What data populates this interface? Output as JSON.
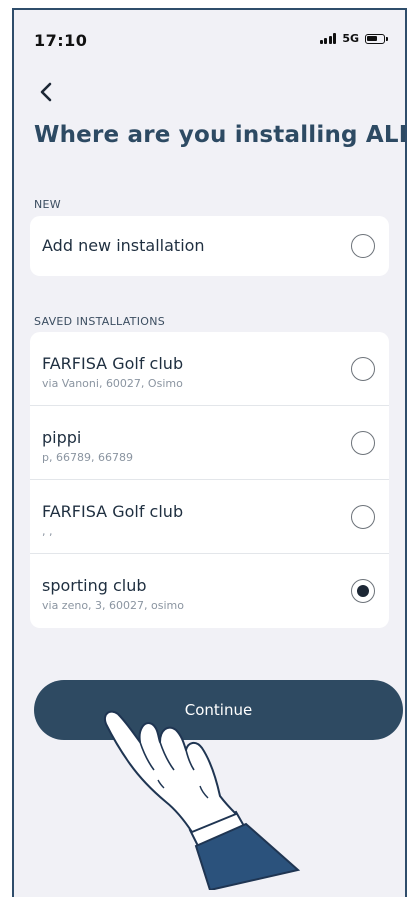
{
  "status": {
    "time": "17:10",
    "network": "5G"
  },
  "nav": {
    "back_icon": "chevron-left-icon"
  },
  "page": {
    "title": "Where are you installing ALBA?"
  },
  "new_section": {
    "label": "NEW",
    "item": {
      "title": "Add new installation",
      "selected": false
    }
  },
  "saved_section": {
    "label": "SAVED INSTALLATIONS",
    "items": [
      {
        "title": "FARFISA Golf club",
        "subtitle": "via Vanoni, 60027, Osimo",
        "selected": false
      },
      {
        "title": "pippi",
        "subtitle": "p, 66789, 66789",
        "selected": false
      },
      {
        "title": "FARFISA Golf club",
        "subtitle": ", ,",
        "selected": false
      },
      {
        "title": "sporting club",
        "subtitle": "via zeno, 3, 60027, osimo",
        "selected": true
      }
    ]
  },
  "actions": {
    "continue_label": "Continue"
  },
  "colors": {
    "primary": "#2e4a62",
    "background": "#f1f1f6",
    "title": "#2d4a63"
  },
  "overlay": {
    "icon": "pointing-hand-icon"
  }
}
